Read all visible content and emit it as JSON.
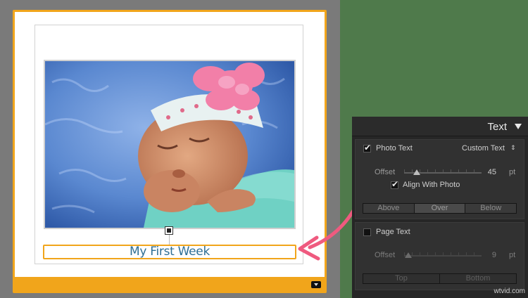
{
  "book_page": {
    "caption_text": "My First Week"
  },
  "text_panel": {
    "title": "Text",
    "photo_text": {
      "label": "Photo Text",
      "checked": true,
      "mode_value": "Custom Text",
      "offset_label": "Offset",
      "offset_value": "45",
      "offset_unit": "pt",
      "align_label": "Align With Photo",
      "align_checked": true,
      "position_buttons": [
        "Above",
        "Over",
        "Below"
      ],
      "active_position": "Over"
    },
    "page_text": {
      "label": "Page Text",
      "checked": false,
      "offset_label": "Offset",
      "offset_value": "9",
      "offset_unit": "pt",
      "position_buttons": [
        "Top",
        "Bottom"
      ]
    }
  },
  "watermark": "wtvid.com",
  "colors": {
    "accent_orange": "#f1a51b",
    "caption_blue": "#2f6f95",
    "arrow_pink": "#ef5a7f",
    "green_background": "#4f7a4b"
  },
  "icons": {
    "collapse": "triangle-down",
    "select": "up-down-chevrons",
    "page_menu": "dropdown-arrow"
  }
}
